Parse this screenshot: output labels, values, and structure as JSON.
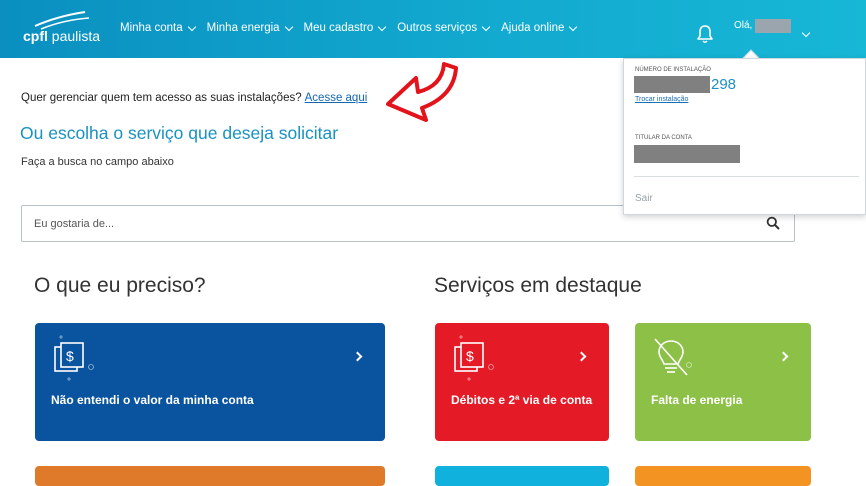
{
  "header": {
    "logo_brand": "cpfl",
    "logo_sub": "paulista",
    "nav": [
      {
        "label": "Minha conta"
      },
      {
        "label": "Minha energia"
      },
      {
        "label": "Meu cadastro"
      },
      {
        "label": "Outros serviços"
      },
      {
        "label": "Ajuda online"
      }
    ],
    "greeting": "Olá,"
  },
  "main": {
    "question": "Quer gerenciar quem tem acesso as suas instalações?",
    "access_link": "Acesse aqui",
    "choose_title": "Ou escolha o serviço que deseja solicitar",
    "search_hint": "Faça a busca no campo abaixo",
    "search_placeholder": "Eu gostaria de..."
  },
  "sections": {
    "need_title": "O que eu preciso?",
    "featured_title": "Serviços em destaque"
  },
  "cards": {
    "blue": "Não entendi o valor da minha conta",
    "red": "Débitos e 2ª via de conta",
    "green": "Falta de energia"
  },
  "dropdown": {
    "install_label": "NÚMERO DE INSTALAÇÃO",
    "install_suffix": "298",
    "change_link": "Trocar instalação",
    "holder_label": "TITULAR DA CONTA",
    "exit": "Sair"
  },
  "colors": {
    "header_gradient_start": "#0a8fc0",
    "header_gradient_end": "#17b7d6",
    "card_blue": "#0a549f",
    "card_red": "#e51a27",
    "card_green": "#8cc046",
    "card_orange": "#e07a2b",
    "card_cyan": "#11b1de",
    "card_amber": "#f39322",
    "annotation_arrow": "#e3131c"
  },
  "icons": [
    "logo-swoosh-icon",
    "chevron-down-icon",
    "bell-icon",
    "search-icon",
    "bill-document-icon",
    "lightbulb-off-icon",
    "chevron-right-icon",
    "curved-arrow-annotation"
  ]
}
